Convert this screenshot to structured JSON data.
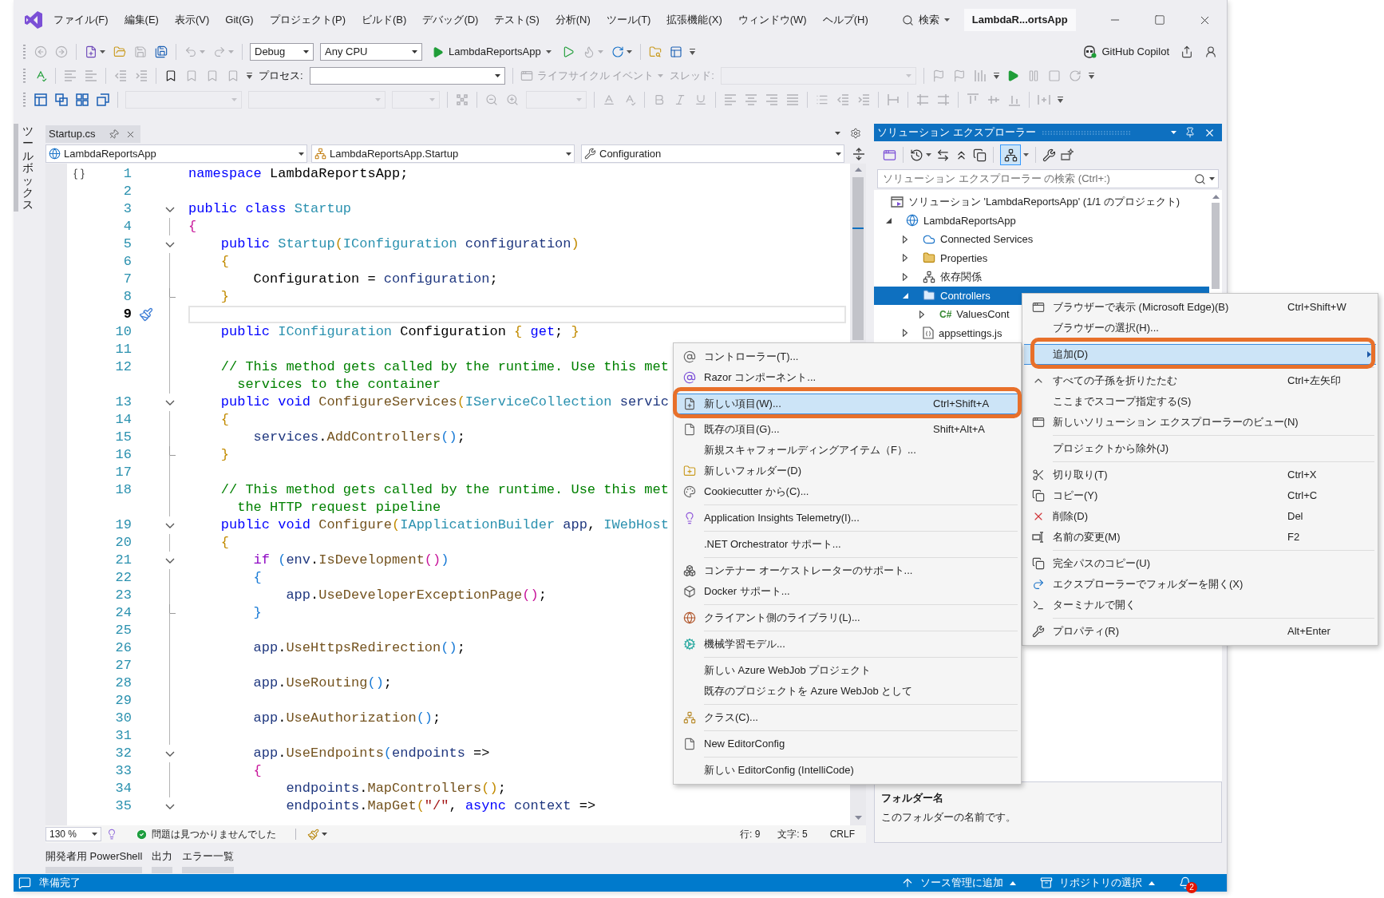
{
  "window": {
    "title": "LambdaR...ortsApp"
  },
  "menu_bar": [
    "ファイル(F)",
    "編集(E)",
    "表示(V)",
    "Git(G)",
    "プロジェクト(P)",
    "ビルド(B)",
    "デバッグ(D)",
    "テスト(S)",
    "分析(N)",
    "ツール(T)",
    "拡張機能(X)",
    "ウィンドウ(W)",
    "ヘルプ(H)"
  ],
  "search": {
    "label": "検索"
  },
  "toolbars": [
    {
      "items": [
        {
          "kind": "grip"
        },
        {
          "kind": "icon",
          "disabled": true
        },
        {
          "kind": "icon",
          "disabled": true
        },
        {
          "kind": "separator"
        },
        {
          "kind": "icon",
          "disabled": false,
          "menu": true
        },
        {
          "kind": "icon",
          "disabled": false
        },
        {
          "kind": "icon",
          "disabled": true
        },
        {
          "kind": "icon",
          "disabled": false
        },
        {
          "kind": "separator"
        },
        {
          "kind": "icon",
          "disabled": true,
          "menu": true
        },
        {
          "kind": "icon",
          "disabled": true,
          "menu": true
        },
        {
          "kind": "separator"
        },
        {
          "kind": "combo",
          "value": "Debug",
          "disabled": false
        },
        {
          "kind": "combo",
          "value": "Any CPU",
          "disabled": false
        },
        {
          "kind": "run",
          "label": "LambdaReportsApp",
          "menu": true
        },
        {
          "kind": "icon",
          "disabled": false
        },
        {
          "kind": "icon",
          "disabled": true,
          "menu": true
        },
        {
          "kind": "icon",
          "disabled": false,
          "menu": true
        },
        {
          "kind": "separator"
        },
        {
          "kind": "icon",
          "disabled": false
        },
        {
          "kind": "icon",
          "disabled": false
        },
        {
          "kind": "overflow"
        }
      ]
    },
    {
      "items": [
        {
          "kind": "grip"
        },
        {
          "kind": "icon",
          "disabled": false
        },
        {
          "kind": "separator"
        },
        {
          "kind": "icon",
          "disabled": true
        },
        {
          "kind": "icon",
          "disabled": true
        },
        {
          "kind": "separator"
        },
        {
          "kind": "icon",
          "disabled": true
        },
        {
          "kind": "icon",
          "disabled": true
        },
        {
          "kind": "separator"
        },
        {
          "kind": "icon",
          "disabled": false
        },
        {
          "kind": "icon",
          "disabled": true
        },
        {
          "kind": "icon",
          "disabled": true
        },
        {
          "kind": "icon",
          "disabled": true
        },
        {
          "kind": "overflow"
        },
        {
          "kind": "label",
          "text": "プロセス:",
          "disabled": false
        },
        {
          "kind": "combo",
          "disabled": false
        },
        {
          "kind": "separator"
        },
        {
          "kind": "menu_button",
          "label": "ライフサイクル イベント",
          "disabled": true
        },
        {
          "kind": "label",
          "text": "スレッド:",
          "disabled": true
        },
        {
          "kind": "combo",
          "disabled": true
        },
        {
          "kind": "separator"
        },
        {
          "kind": "icon",
          "disabled": true
        },
        {
          "kind": "icon",
          "disabled": true
        },
        {
          "kind": "icon",
          "disabled": true
        },
        {
          "kind": "overflow"
        },
        {
          "kind": "icon",
          "disabled": false
        },
        {
          "kind": "icon",
          "disabled": true
        },
        {
          "kind": "icon",
          "disabled": true
        },
        {
          "kind": "icon",
          "disabled": true
        },
        {
          "kind": "overflow"
        }
      ]
    },
    {
      "items": [
        {
          "kind": "grip"
        },
        {
          "kind": "icon",
          "disabled": false
        },
        {
          "kind": "icon",
          "disabled": false
        },
        {
          "kind": "icon",
          "disabled": false
        },
        {
          "kind": "icon",
          "disabled": false
        },
        {
          "kind": "separator"
        },
        {
          "kind": "combo",
          "disabled": true
        },
        {
          "kind": "combo",
          "disabled": true
        },
        {
          "kind": "combo",
          "disabled": true
        },
        {
          "kind": "separator"
        },
        {
          "kind": "icon",
          "disabled": true
        },
        {
          "kind": "separator"
        },
        {
          "kind": "icon",
          "disabled": true
        },
        {
          "kind": "icon",
          "disabled": true
        },
        {
          "kind": "combo",
          "disabled": true
        },
        {
          "kind": "separator"
        },
        {
          "kind": "icon",
          "disabled": true
        },
        {
          "kind": "icon",
          "disabled": true
        },
        {
          "kind": "separator"
        },
        {
          "kind": "icon",
          "disabled": true
        },
        {
          "kind": "icon",
          "disabled": true
        },
        {
          "kind": "icon",
          "disabled": true
        },
        {
          "kind": "separator"
        },
        {
          "kind": "icon",
          "disabled": true
        },
        {
          "kind": "icon",
          "disabled": true
        },
        {
          "kind": "icon",
          "disabled": true
        },
        {
          "kind": "icon",
          "disabled": true
        },
        {
          "kind": "separator"
        },
        {
          "kind": "icon",
          "disabled": true
        },
        {
          "kind": "icon",
          "disabled": true
        },
        {
          "kind": "icon",
          "disabled": true
        },
        {
          "kind": "separator"
        },
        {
          "kind": "icon",
          "disabled": true
        },
        {
          "kind": "separator"
        },
        {
          "kind": "icon",
          "disabled": true
        },
        {
          "kind": "icon",
          "disabled": true
        },
        {
          "kind": "separator"
        },
        {
          "kind": "icon",
          "disabled": true
        },
        {
          "kind": "icon",
          "disabled": true
        },
        {
          "kind": "icon",
          "disabled": true
        },
        {
          "kind": "separator"
        },
        {
          "kind": "icon",
          "disabled": true
        },
        {
          "kind": "overflow"
        }
      ]
    }
  ],
  "copilot": {
    "label": "GitHub Copilot"
  },
  "toolbox": {
    "label": "ツールボックス"
  },
  "editor": {
    "tab": {
      "label": "Startup.cs"
    },
    "navigation": [
      "LambdaReportsApp",
      "LambdaReportsApp.Startup",
      "Configuration"
    ],
    "lines": [
      {
        "number": "1",
        "gutter_icon": true,
        "tokens": [
          {
            "kind": "keyword",
            "text": "namespace"
          },
          {
            "kind": "plain",
            "text": " LambdaReportsApp;"
          }
        ]
      },
      {
        "number": "2"
      },
      {
        "number": "3",
        "collapsible": true,
        "tokens": [
          {
            "kind": "keyword",
            "text": "public class "
          },
          {
            "kind": "type",
            "text": "Startup"
          }
        ]
      },
      {
        "number": "4",
        "tokens": [
          {
            "kind": "brace_magenta",
            "text": "{"
          }
        ]
      },
      {
        "number": "5",
        "collapsible": true,
        "tokens": [
          {
            "kind": "keyword",
            "text": "    public "
          },
          {
            "kind": "type",
            "text": "Startup"
          },
          {
            "kind": "brace_gold",
            "text": "("
          },
          {
            "kind": "type",
            "text": "IConfiguration"
          },
          {
            "kind": "param",
            "text": " configuration"
          },
          {
            "kind": "brace_gold",
            "text": ")"
          }
        ]
      },
      {
        "number": "6",
        "tokens": [
          {
            "kind": "brace_gold",
            "text": "    {"
          }
        ]
      },
      {
        "number": "7",
        "tokens": [
          {
            "kind": "plain",
            "text": "        Configuration = "
          },
          {
            "kind": "param",
            "text": "configuration"
          },
          {
            "kind": "plain",
            "text": ";"
          }
        ]
      },
      {
        "number": "8",
        "block_end": true,
        "tokens": [
          {
            "kind": "brace_gold",
            "text": "    }"
          }
        ]
      },
      {
        "number": "9",
        "current": true
      },
      {
        "number": "10",
        "tokens": [
          {
            "kind": "keyword",
            "text": "    public "
          },
          {
            "kind": "type",
            "text": "IConfiguration"
          },
          {
            "kind": "plain",
            "text": " Configuration "
          },
          {
            "kind": "brace_gold",
            "text": "{"
          },
          {
            "kind": "keyword",
            "text": " get"
          },
          {
            "kind": "plain",
            "text": "; "
          },
          {
            "kind": "brace_gold",
            "text": "}"
          }
        ]
      },
      {
        "number": "11"
      },
      {
        "number": "12",
        "tokens": [
          {
            "kind": "comment",
            "text": "    // This method gets called by the runtime. Use this met"
          }
        ],
        "wrap": [
          {
            "kind": "comment",
            "text": "      services to the container"
          }
        ]
      },
      {
        "number": "13",
        "collapsible": true,
        "tokens": [
          {
            "kind": "keyword",
            "text": "    public void "
          },
          {
            "kind": "method",
            "text": "ConfigureServices"
          },
          {
            "kind": "brace_gold",
            "text": "("
          },
          {
            "kind": "type",
            "text": "IServiceCollection"
          },
          {
            "kind": "param",
            "text": " servic"
          }
        ]
      },
      {
        "number": "14",
        "tokens": [
          {
            "kind": "brace_gold",
            "text": "    {"
          }
        ]
      },
      {
        "number": "15",
        "tokens": [
          {
            "kind": "param",
            "text": "        services"
          },
          {
            "kind": "plain",
            "text": "."
          },
          {
            "kind": "method",
            "text": "AddControllers"
          },
          {
            "kind": "brace_blue",
            "text": "()"
          },
          {
            "kind": "plain",
            "text": ";"
          }
        ]
      },
      {
        "number": "16",
        "block_end": true,
        "tokens": [
          {
            "kind": "brace_gold",
            "text": "    }"
          }
        ]
      },
      {
        "number": "17"
      },
      {
        "number": "18",
        "tokens": [
          {
            "kind": "comment",
            "text": "    // This method gets called by the runtime. Use this met"
          }
        ],
        "wrap": [
          {
            "kind": "comment",
            "text": "      the HTTP request pipeline"
          }
        ]
      },
      {
        "number": "19",
        "collapsible": true,
        "tokens": [
          {
            "kind": "keyword",
            "text": "    public void "
          },
          {
            "kind": "method",
            "text": "Configure"
          },
          {
            "kind": "brace_gold",
            "text": "("
          },
          {
            "kind": "type",
            "text": "IApplicationBuilder"
          },
          {
            "kind": "param",
            "text": " app"
          },
          {
            "kind": "plain",
            "text": ", "
          },
          {
            "kind": "type",
            "text": "IWebHost"
          }
        ]
      },
      {
        "number": "20",
        "tokens": [
          {
            "kind": "brace_gold",
            "text": "    {"
          }
        ]
      },
      {
        "number": "21",
        "collapsible": true,
        "tokens": [
          {
            "kind": "control",
            "text": "        if "
          },
          {
            "kind": "brace_blue",
            "text": "("
          },
          {
            "kind": "param",
            "text": "env"
          },
          {
            "kind": "plain",
            "text": "."
          },
          {
            "kind": "method",
            "text": "IsDevelopment"
          },
          {
            "kind": "brace_magenta",
            "text": "()"
          },
          {
            "kind": "brace_blue",
            "text": ")"
          }
        ]
      },
      {
        "number": "22",
        "tokens": [
          {
            "kind": "brace_blue",
            "text": "        {"
          }
        ]
      },
      {
        "number": "23",
        "tokens": [
          {
            "kind": "param",
            "text": "            app"
          },
          {
            "kind": "plain",
            "text": "."
          },
          {
            "kind": "method",
            "text": "UseDeveloperExceptionPage"
          },
          {
            "kind": "brace_magenta",
            "text": "()"
          },
          {
            "kind": "plain",
            "text": ";"
          }
        ]
      },
      {
        "number": "24",
        "block_end": true,
        "tokens": [
          {
            "kind": "brace_blue",
            "text": "        }"
          }
        ]
      },
      {
        "number": "25"
      },
      {
        "number": "26",
        "tokens": [
          {
            "kind": "param",
            "text": "        app"
          },
          {
            "kind": "plain",
            "text": "."
          },
          {
            "kind": "method",
            "text": "UseHttpsRedirection"
          },
          {
            "kind": "brace_blue",
            "text": "()"
          },
          {
            "kind": "plain",
            "text": ";"
          }
        ]
      },
      {
        "number": "27"
      },
      {
        "number": "28",
        "tokens": [
          {
            "kind": "param",
            "text": "        app"
          },
          {
            "kind": "plain",
            "text": "."
          },
          {
            "kind": "method",
            "text": "UseRouting"
          },
          {
            "kind": "brace_blue",
            "text": "()"
          },
          {
            "kind": "plain",
            "text": ";"
          }
        ]
      },
      {
        "number": "29"
      },
      {
        "number": "30",
        "tokens": [
          {
            "kind": "param",
            "text": "        app"
          },
          {
            "kind": "plain",
            "text": "."
          },
          {
            "kind": "method",
            "text": "UseAuthorization"
          },
          {
            "kind": "brace_blue",
            "text": "()"
          },
          {
            "kind": "plain",
            "text": ";"
          }
        ]
      },
      {
        "number": "31"
      },
      {
        "number": "32",
        "collapsible": true,
        "tokens": [
          {
            "kind": "param",
            "text": "        app"
          },
          {
            "kind": "plain",
            "text": "."
          },
          {
            "kind": "method",
            "text": "UseEndpoints"
          },
          {
            "kind": "brace_blue",
            "text": "("
          },
          {
            "kind": "param",
            "text": "endpoints"
          },
          {
            "kind": "plain",
            "text": " =>"
          }
        ]
      },
      {
        "number": "33",
        "tokens": [
          {
            "kind": "brace_magenta",
            "text": "        {"
          }
        ]
      },
      {
        "number": "34",
        "tokens": [
          {
            "kind": "param",
            "text": "            endpoints"
          },
          {
            "kind": "plain",
            "text": "."
          },
          {
            "kind": "method",
            "text": "MapControllers"
          },
          {
            "kind": "brace_gold",
            "text": "()"
          },
          {
            "kind": "plain",
            "text": ";"
          }
        ]
      },
      {
        "number": "35",
        "collapsible": true,
        "tokens": [
          {
            "kind": "param",
            "text": "            endpoints"
          },
          {
            "kind": "plain",
            "text": "."
          },
          {
            "kind": "method",
            "text": "MapGet"
          },
          {
            "kind": "brace_gold",
            "text": "("
          },
          {
            "kind": "string",
            "text": "\"/\""
          },
          {
            "kind": "plain",
            "text": ", "
          },
          {
            "kind": "keyword",
            "text": "async"
          },
          {
            "kind": "param",
            "text": " context"
          },
          {
            "kind": "plain",
            "text": " =>"
          }
        ]
      }
    ],
    "status": {
      "zoom": "130 %",
      "problems": "問題は見つかりませんでした",
      "line": "行: 9",
      "column": "文字: 5",
      "line_ending": "CRLF"
    }
  },
  "solution_explorer": {
    "title": "ソリューション エクスプローラー",
    "toolbar": [
      {
        "kind": "icon",
        "pressed": false
      },
      {
        "kind": "separator"
      },
      {
        "kind": "icon",
        "pressed": false,
        "menu": true
      },
      {
        "kind": "icon",
        "pressed": false
      },
      {
        "kind": "icon",
        "pressed": false
      },
      {
        "kind": "icon",
        "pressed": false
      },
      {
        "kind": "separator"
      },
      {
        "kind": "icon",
        "pressed": true,
        "menu": true
      },
      {
        "kind": "separator"
      },
      {
        "kind": "icon",
        "pressed": false
      },
      {
        "kind": "icon",
        "pressed": false
      }
    ],
    "search": {
      "placeholder": "ソリューション エクスプローラー の検索 (Ctrl+:)"
    },
    "tree": [
      {
        "label": "ソリューション 'LambdaReportsApp' (1/1 のプロジェクト)",
        "selected": false,
        "children": [
          {
            "label": "LambdaReportsApp",
            "expanded": true,
            "selected": false,
            "children": [
              {
                "label": "Connected Services",
                "expanded": false,
                "selected": false
              },
              {
                "label": "Properties",
                "expanded": false,
                "selected": false
              },
              {
                "label": "依存関係",
                "expanded": false,
                "selected": false
              },
              {
                "label": "Controllers",
                "expanded": true,
                "selected": true,
                "children": [
                  {
                    "label": "ValuesCont",
                    "icon_text": "C#",
                    "expanded": false,
                    "selected": false
                  }
                ]
              },
              {
                "label": "appsettings.js",
                "expanded": false,
                "selected": false
              }
            ]
          }
        ]
      }
    ],
    "properties": {
      "name": "フォルダー名",
      "description": "このフォルダーの名前です。"
    }
  },
  "context_menu": {
    "items": [
      {
        "kind": "item",
        "label": "ブラウザーで表示 (Microsoft Edge)(B)",
        "shortcut": "Ctrl+Shift+W",
        "selected": false
      },
      {
        "kind": "item",
        "label": "ブラウザーの選択(H)...",
        "selected": false
      },
      {
        "kind": "separator"
      },
      {
        "kind": "item",
        "label": "追加(D)",
        "submenu": true,
        "selected": true
      },
      {
        "kind": "separator"
      },
      {
        "kind": "item",
        "label": "すべての子孫を折りたたむ",
        "shortcut": "Ctrl+左矢印",
        "selected": false
      },
      {
        "kind": "item",
        "label": "ここまでスコープ指定する(S)",
        "selected": false
      },
      {
        "kind": "item",
        "label": "新しいソリューション エクスプローラーのビュー(N)",
        "selected": false
      },
      {
        "kind": "separator"
      },
      {
        "kind": "item",
        "label": "プロジェクトから除外(J)",
        "selected": false
      },
      {
        "kind": "separator"
      },
      {
        "kind": "item",
        "label": "切り取り(T)",
        "shortcut": "Ctrl+X",
        "selected": false
      },
      {
        "kind": "item",
        "label": "コピー(Y)",
        "shortcut": "Ctrl+C",
        "selected": false
      },
      {
        "kind": "item",
        "label": "削除(D)",
        "shortcut": "Del",
        "selected": false
      },
      {
        "kind": "item",
        "label": "名前の変更(M)",
        "shortcut": "F2",
        "selected": false
      },
      {
        "kind": "separator"
      },
      {
        "kind": "item",
        "label": "完全パスのコピー(U)",
        "selected": false
      },
      {
        "kind": "item",
        "label": "エクスプローラーでフォルダーを開く(X)",
        "selected": false
      },
      {
        "kind": "item",
        "label": "ターミナルで開く",
        "selected": false
      },
      {
        "kind": "separator"
      },
      {
        "kind": "item",
        "label": "プロパティ(R)",
        "shortcut": "Alt+Enter",
        "selected": false
      }
    ]
  },
  "submenu": {
    "items": [
      {
        "kind": "item",
        "label": "コントローラー(T)...",
        "selected": false
      },
      {
        "kind": "item",
        "label": "Razor コンポーネント...",
        "selected": false
      },
      {
        "kind": "separator"
      },
      {
        "kind": "item",
        "label": "新しい項目(W)...",
        "shortcut": "Ctrl+Shift+A",
        "selected": true
      },
      {
        "kind": "item",
        "label": "既存の項目(G)...",
        "shortcut": "Shift+Alt+A",
        "selected": false
      },
      {
        "kind": "item",
        "label": "新規スキャフォールディングアイテム（F）...",
        "selected": false
      },
      {
        "kind": "item",
        "label": "新しいフォルダー(D)",
        "selected": false
      },
      {
        "kind": "item",
        "label": "Cookiecutter から(C)...",
        "selected": false
      },
      {
        "kind": "separator"
      },
      {
        "kind": "item",
        "label": "Application Insights Telemetry(I)...",
        "selected": false
      },
      {
        "kind": "separator"
      },
      {
        "kind": "item",
        "label": ".NET Orchestrator サポート...",
        "selected": false
      },
      {
        "kind": "separator"
      },
      {
        "kind": "item",
        "label": "コンテナー オーケストレーターのサポート...",
        "selected": false
      },
      {
        "kind": "item",
        "label": "Docker サポート...",
        "selected": false
      },
      {
        "kind": "separator"
      },
      {
        "kind": "item",
        "label": "クライアント側のライブラリ(L)...",
        "selected": false
      },
      {
        "kind": "separator"
      },
      {
        "kind": "item",
        "label": "機械学習モデル...",
        "selected": false
      },
      {
        "kind": "separator"
      },
      {
        "kind": "item",
        "label": "新しい Azure WebJob プロジェクト",
        "selected": false
      },
      {
        "kind": "item",
        "label": "既存のプロジェクトを Azure WebJob として",
        "selected": false
      },
      {
        "kind": "separator"
      },
      {
        "kind": "item",
        "label": "クラス(C)...",
        "selected": false
      },
      {
        "kind": "separator"
      },
      {
        "kind": "item",
        "label": "New EditorConfig",
        "selected": false
      },
      {
        "kind": "separator"
      },
      {
        "kind": "item",
        "label": "新しい EditorConfig (IntelliCode)",
        "selected": false
      }
    ]
  },
  "bottom_tabs": [
    {
      "label": "開発者用 PowerShell"
    },
    {
      "label": "出力"
    },
    {
      "label": "エラー一覧"
    }
  ],
  "status_bar": {
    "message": "準備完了",
    "items": [
      {
        "label": "ソース管理に追加"
      },
      {
        "label": "リポジトリの選択"
      }
    ],
    "notifications": "2"
  }
}
